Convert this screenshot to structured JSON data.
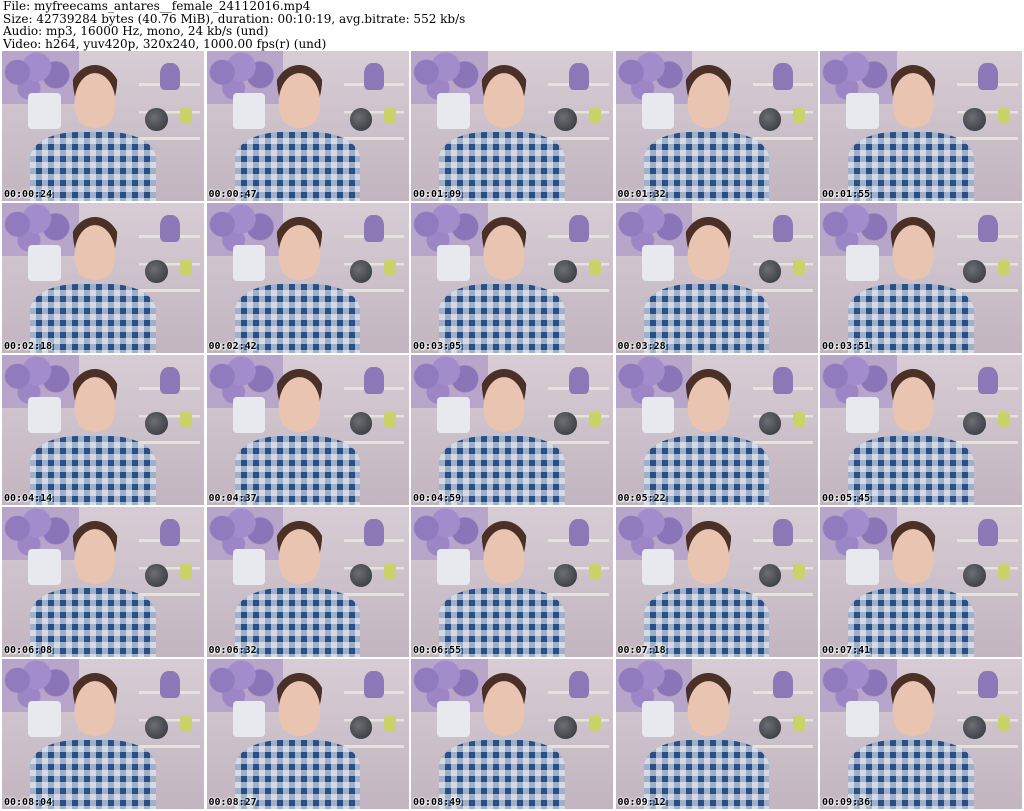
{
  "header": {
    "file": "File: myfreecams_antares__female_24112016.mp4",
    "size": "Size: 42739284 bytes (40.76 MiB), duration: 00:10:19, avg.bitrate: 552 kb/s",
    "audio": "Audio: mp3, 16000 Hz, mono, 24 kb/s (und)",
    "video": "Video: h264, yuv420p, 320x240, 1000.00 fps(r) (und)"
  },
  "thumbnails": [
    {
      "timestamp": "00:00:24"
    },
    {
      "timestamp": "00:00:47"
    },
    {
      "timestamp": "00:01:09"
    },
    {
      "timestamp": "00:01:32"
    },
    {
      "timestamp": "00:01:55"
    },
    {
      "timestamp": "00:02:18"
    },
    {
      "timestamp": "00:02:42"
    },
    {
      "timestamp": "00:03:05"
    },
    {
      "timestamp": "00:03:28"
    },
    {
      "timestamp": "00:03:51"
    },
    {
      "timestamp": "00:04:14"
    },
    {
      "timestamp": "00:04:37"
    },
    {
      "timestamp": "00:04:59"
    },
    {
      "timestamp": "00:05:22"
    },
    {
      "timestamp": "00:05:45"
    },
    {
      "timestamp": "00:06:08"
    },
    {
      "timestamp": "00:06:32"
    },
    {
      "timestamp": "00:06:55"
    },
    {
      "timestamp": "00:07:18"
    },
    {
      "timestamp": "00:07:41"
    },
    {
      "timestamp": "00:08:04"
    },
    {
      "timestamp": "00:08:27"
    },
    {
      "timestamp": "00:08:49"
    },
    {
      "timestamp": "00:09:12"
    },
    {
      "timestamp": "00:09:36"
    }
  ]
}
